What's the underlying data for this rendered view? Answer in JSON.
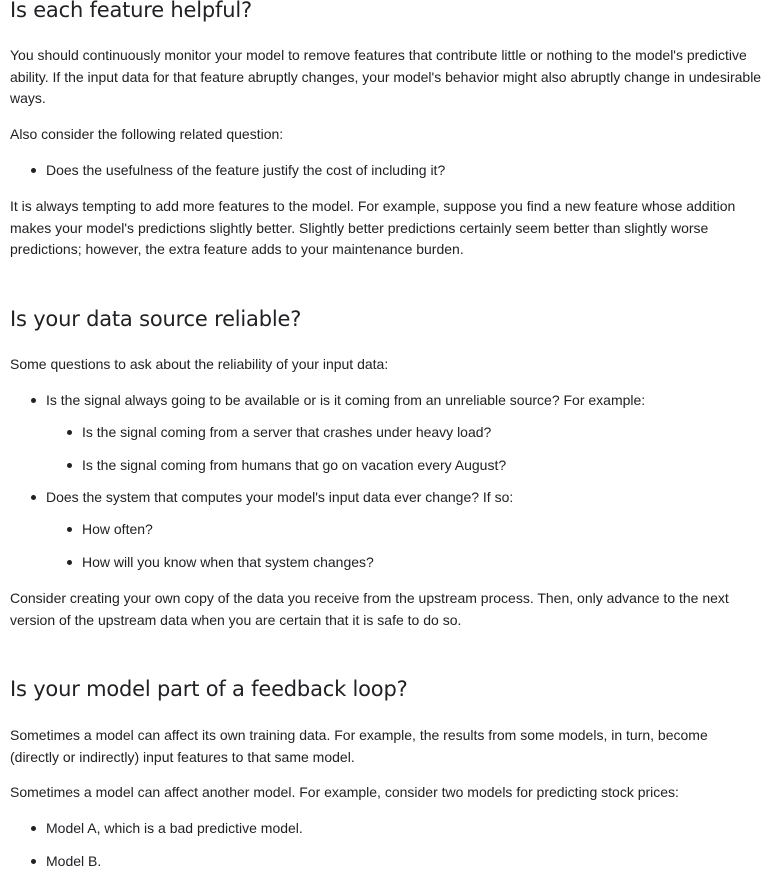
{
  "section1": {
    "heading": "Is each feature helpful?",
    "para1": "You should continuously monitor your model to remove features that contribute little or nothing to the model's predictive ability. If the input data for that feature abruptly changes, your model's behavior might also abruptly change in undesirable ways.",
    "para2": "Also consider the following related question:",
    "bullets": [
      "Does the usefulness of the feature justify the cost of including it?"
    ],
    "para3": "It is always tempting to add more features to the model. For example, suppose you find a new feature whose addition makes your model's predictions slightly better. Slightly better predictions certainly seem better than slightly worse predictions; however, the extra feature adds to your maintenance burden."
  },
  "section2": {
    "heading": "Is your data source reliable?",
    "intro": "Some questions to ask about the reliability of your input data:",
    "bullet1": "Is the signal always going to be available or is it coming from an unreliable source? For example:",
    "bullet1_sub": [
      "Is the signal coming from a server that crashes under heavy load?",
      "Is the signal coming from humans that go on vacation every August?"
    ],
    "bullet2": "Does the system that computes your model's input data ever change? If so:",
    "bullet2_sub": [
      "How often?",
      "How will you know when that system changes?"
    ],
    "outro": "Consider creating your own copy of the data you receive from the upstream process. Then, only advance to the next version of the upstream data when you are certain that it is safe to do so."
  },
  "section3": {
    "heading": "Is your model part of a feedback loop?",
    "para1": "Sometimes a model can affect its own training data. For example, the results from some models, in turn, become (directly or indirectly) input features to that same model.",
    "para2": "Sometimes a model can affect another model. For example, consider two models for predicting stock prices:",
    "bullets": [
      "Model A, which is a bad predictive model.",
      "Model B."
    ]
  }
}
